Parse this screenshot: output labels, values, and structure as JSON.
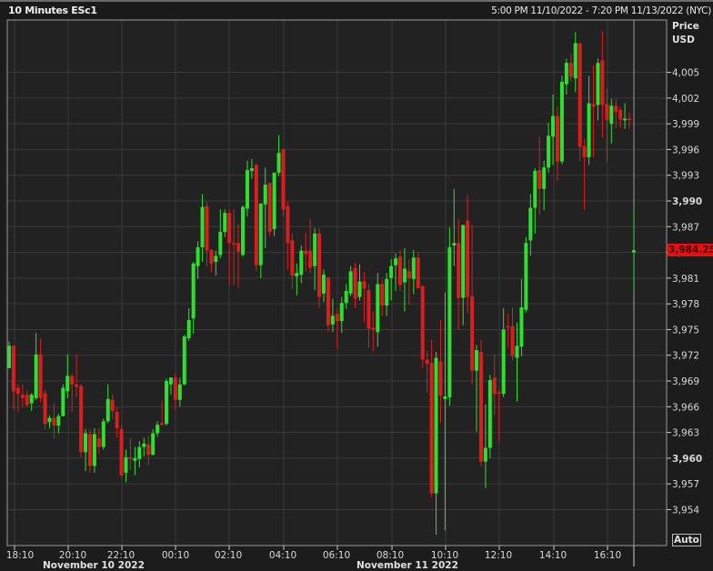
{
  "header": {
    "title": "10 Minutes ESc1",
    "range": "5:00 PM 11/10/2022 - 7:20 PM 11/13/2022 (NYC)"
  },
  "axis": {
    "price_label": "Price",
    "currency_label": "USD",
    "auto_button": "Auto"
  },
  "last_price": "3,984.25",
  "colors": {
    "up": "#2de02d",
    "down": "#d81e1e",
    "background": "#222222",
    "grid": "#3a3a3a",
    "last_price_bg": "#e61010"
  },
  "dates": [
    "November 10 2022",
    "November 11 2022"
  ],
  "chart_data": {
    "type": "candlestick",
    "title": "10 Minutes ESc1",
    "ylabel": "Price USD",
    "ylim": [
      3951,
      4010
    ],
    "grid": true,
    "y_ticks": [
      4005,
      4002,
      3999,
      3996,
      3993,
      3990,
      3987,
      3984,
      3981,
      3978,
      3975,
      3972,
      3969,
      3966,
      3963,
      3960,
      3957,
      3954
    ],
    "y_tick_labels": [
      "4,005",
      "4,002",
      "3,999",
      "3,996",
      "3,993",
      "3,990",
      "3,987",
      "3,984",
      "3,981",
      "3,978",
      "3,975",
      "3,972",
      "3,969",
      "3,966",
      "3,963",
      "3,960",
      "3,957",
      "3,954"
    ],
    "x_tick_labels": [
      "18:10",
      "20:10",
      "22:10",
      "00:10",
      "02:10",
      "04:10",
      "06:10",
      "08:10",
      "10:10",
      "12:10",
      "14:10",
      "16:10"
    ],
    "last": 3984.25,
    "ohlc": [
      [
        3970.5,
        3973.6,
        3970.5,
        3973.1
      ],
      [
        3973.1,
        3973.1,
        3965.7,
        3967.8
      ],
      [
        3968.2,
        3968.6,
        3965.4,
        3967.5
      ],
      [
        3967.4,
        3968.6,
        3966.0,
        3967.0
      ],
      [
        3967.4,
        3967.9,
        3966.0,
        3966.2
      ],
      [
        3966.4,
        3967.6,
        3965.5,
        3967.4
      ],
      [
        3967.0,
        3974.6,
        3966.8,
        3972.1
      ],
      [
        3972.1,
        3973.9,
        3966.5,
        3967.0
      ],
      [
        3967.6,
        3968.0,
        3963.3,
        3964.0
      ],
      [
        3964.2,
        3965.0,
        3963.5,
        3964.7
      ],
      [
        3964.7,
        3966.4,
        3962.3,
        3963.8
      ],
      [
        3963.8,
        3965.2,
        3962.9,
        3964.9
      ],
      [
        3964.9,
        3968.6,
        3964.9,
        3968.2
      ],
      [
        3967.8,
        3972.1,
        3967.0,
        3969.6
      ],
      [
        3969.6,
        3969.8,
        3965.4,
        3968.6
      ],
      [
        3968.6,
        3972.1,
        3967.1,
        3968.3
      ],
      [
        3968.4,
        3968.6,
        3960.1,
        3960.7
      ],
      [
        3960.7,
        3963.4,
        3958.5,
        3962.9
      ],
      [
        3962.8,
        3963.3,
        3958.3,
        3959.1
      ],
      [
        3959.1,
        3963.5,
        3958.3,
        3962.8
      ],
      [
        3962.3,
        3963.5,
        3960.5,
        3961.3
      ],
      [
        3961.3,
        3964.6,
        3961.0,
        3964.3
      ],
      [
        3964.3,
        3968.6,
        3964.1,
        3966.9
      ],
      [
        3966.8,
        3967.4,
        3964.6,
        3965.5
      ],
      [
        3965.4,
        3966.0,
        3962.4,
        3963.5
      ],
      [
        3963.4,
        3963.9,
        3957.8,
        3958.0
      ],
      [
        3958.3,
        3961.0,
        3957.2,
        3960.1
      ],
      [
        3960.1,
        3962.3,
        3958.6,
        3959.9
      ],
      [
        3959.7,
        3961.3,
        3958.0,
        3960.0
      ],
      [
        3959.9,
        3962.0,
        3958.9,
        3961.3
      ],
      [
        3961.3,
        3962.4,
        3960.2,
        3961.7
      ],
      [
        3961.6,
        3962.6,
        3959.2,
        3960.4
      ],
      [
        3960.4,
        3963.4,
        3960.3,
        3962.9
      ],
      [
        3962.9,
        3964.3,
        3962.5,
        3963.9
      ],
      [
        3964.1,
        3966.7,
        3963.8,
        3963.9
      ],
      [
        3964.0,
        3969.3,
        3963.8,
        3969.0
      ],
      [
        3968.6,
        3969.4,
        3967.4,
        3969.4
      ],
      [
        3969.4,
        3969.9,
        3965.6,
        3966.8
      ],
      [
        3966.8,
        3969.4,
        3966.0,
        3968.6
      ],
      [
        3968.6,
        3974.4,
        3968.5,
        3974.2
      ],
      [
        3974.0,
        3977.5,
        3973.7,
        3976.1
      ],
      [
        3976.3,
        3982.9,
        3974.5,
        3982.7
      ],
      [
        3982.4,
        3985.3,
        3980.9,
        3984.6
      ],
      [
        3984.6,
        3990.8,
        3982.9,
        3989.3
      ],
      [
        3989.4,
        3989.9,
        3982.4,
        3984.2
      ],
      [
        3984.3,
        3984.4,
        3981.7,
        3982.7
      ],
      [
        3982.9,
        3984.2,
        3981.3,
        3983.6
      ],
      [
        3983.7,
        3989.0,
        3983.3,
        3986.4
      ],
      [
        3986.4,
        3989.0,
        3985.8,
        3988.6
      ],
      [
        3988.6,
        3989.0,
        3980.2,
        3985.1
      ],
      [
        3985.1,
        3989.0,
        3980.2,
        3984.9
      ],
      [
        3985.1,
        3987.3,
        3979.9,
        3984.1
      ],
      [
        3983.7,
        3989.5,
        3983.5,
        3989.3
      ],
      [
        3989.1,
        3994.7,
        3988.2,
        3993.6
      ],
      [
        3993.5,
        3994.9,
        3992.6,
        3993.8
      ],
      [
        3994.2,
        3994.3,
        3981.8,
        3982.5
      ],
      [
        3982.5,
        3989.7,
        3981.0,
        3989.7
      ],
      [
        3989.6,
        3993.9,
        3984.5,
        3991.9
      ],
      [
        3992.1,
        3992.1,
        3985.9,
        3986.4
      ],
      [
        3986.7,
        3993.3,
        3985.9,
        3993.3
      ],
      [
        3993.3,
        3997.7,
        3992.9,
        3995.6
      ],
      [
        3996.0,
        3996.0,
        3988.2,
        3989.0
      ],
      [
        3989.4,
        3989.9,
        3982.0,
        3985.1
      ],
      [
        3985.4,
        3986.2,
        3979.7,
        3981.3
      ],
      [
        3981.2,
        3982.7,
        3979.0,
        3981.6
      ],
      [
        3981.4,
        3984.8,
        3980.4,
        3984.2
      ],
      [
        3984.2,
        3986.3,
        3981.8,
        3983.8
      ],
      [
        3984.2,
        3987.9,
        3981.6,
        3982.2
      ],
      [
        3982.4,
        3986.8,
        3979.6,
        3986.2
      ],
      [
        3986.2,
        3986.8,
        3977.5,
        3978.8
      ],
      [
        3979.2,
        3982.0,
        3978.2,
        3981.4
      ],
      [
        3981.1,
        3981.1,
        3974.7,
        3975.5
      ],
      [
        3975.6,
        3978.6,
        3974.7,
        3976.6
      ],
      [
        3976.8,
        3977.5,
        3972.8,
        3976.0
      ],
      [
        3976.0,
        3978.8,
        3974.6,
        3978.1
      ],
      [
        3978.1,
        3980.3,
        3977.4,
        3979.5
      ],
      [
        3979.2,
        3982.4,
        3978.9,
        3981.8
      ],
      [
        3982.2,
        3982.8,
        3977.5,
        3978.6
      ],
      [
        3978.8,
        3982.6,
        3978.4,
        3980.6
      ],
      [
        3980.6,
        3981.7,
        3975.8,
        3979.8
      ],
      [
        3979.6,
        3980.3,
        3972.9,
        3975.1
      ],
      [
        3975.2,
        3977.1,
        3972.5,
        3975.0
      ],
      [
        3974.7,
        3981.6,
        3973.0,
        3980.3
      ],
      [
        3980.3,
        3980.8,
        3976.6,
        3977.8
      ],
      [
        3977.8,
        3981.6,
        3976.6,
        3980.9
      ],
      [
        3981.0,
        3983.2,
        3978.4,
        3982.4
      ],
      [
        3982.5,
        3983.9,
        3979.5,
        3983.3
      ],
      [
        3983.5,
        3984.3,
        3979.5,
        3980.2
      ],
      [
        3980.5,
        3984.5,
        3977.1,
        3982.1
      ],
      [
        3981.8,
        3983.2,
        3977.9,
        3981.0
      ],
      [
        3980.9,
        3984.3,
        3979.1,
        3983.4
      ],
      [
        3983.4,
        3984.0,
        3979.8,
        3979.8
      ],
      [
        3980.1,
        3980.1,
        3970.5,
        3971.5
      ],
      [
        3971.5,
        3972.5,
        3967.6,
        3971.0
      ],
      [
        3971.1,
        3973.8,
        3955.5,
        3955.9
      ],
      [
        3955.9,
        3972.4,
        3951.1,
        3971.7
      ],
      [
        3971.3,
        3976.1,
        3964.1,
        3967.3
      ],
      [
        3966.9,
        3979.3,
        3951.6,
        3967.2
      ],
      [
        3967.1,
        3986.9,
        3966.1,
        3984.6
      ],
      [
        3984.8,
        3991.4,
        3982.4,
        3985.1
      ],
      [
        3985.1,
        3987.9,
        3975.0,
        3978.7
      ],
      [
        3978.7,
        3987.2,
        3975.5,
        3987.2
      ],
      [
        3987.7,
        3990.7,
        3976.9,
        3978.8
      ],
      [
        3978.9,
        3987.2,
        3968.6,
        3970.2
      ],
      [
        3970.2,
        3973.2,
        3963.1,
        3972.6
      ],
      [
        3972.4,
        3973.8,
        3959.1,
        3959.6
      ],
      [
        3959.6,
        3966.3,
        3956.5,
        3961.2
      ],
      [
        3961.2,
        3969.7,
        3960.0,
        3969.1
      ],
      [
        3969.4,
        3972.1,
        3965.0,
        3967.5
      ],
      [
        3967.7,
        3968.0,
        3962.0,
        3967.5
      ],
      [
        3967.5,
        3977.5,
        3967.1,
        3975.0
      ],
      [
        3975.4,
        3976.9,
        3972.9,
        3975.3
      ],
      [
        3975.4,
        3977.6,
        3971.4,
        3971.9
      ],
      [
        3971.7,
        3975.8,
        3966.6,
        3973.1
      ],
      [
        3973.0,
        3980.9,
        3971.9,
        3977.6
      ],
      [
        3977.3,
        3985.8,
        3977.0,
        3985.1
      ],
      [
        3985.4,
        3990.8,
        3983.6,
        3989.2
      ],
      [
        3989.2,
        3993.8,
        3986.2,
        3993.5
      ],
      [
        3993.6,
        3997.5,
        3988.4,
        3991.4
      ],
      [
        3991.4,
        3994.7,
        3988.9,
        3993.9
      ],
      [
        3993.9,
        3999.1,
        3993.3,
        3997.6
      ],
      [
        3997.5,
        4002.4,
        3994.2,
        3999.9
      ],
      [
        3999.9,
        4001.0,
        3992.3,
        3994.6
      ],
      [
        3994.6,
        4004.6,
        3994.3,
        4003.9
      ],
      [
        4003.6,
        4006.6,
        4002.4,
        4006.1
      ],
      [
        4006.1,
        4007.2,
        4003.9,
        4004.5
      ],
      [
        4004.3,
        4009.7,
        4002.7,
        4008.4
      ],
      [
        4008.4,
        4008.4,
        3994.6,
        3996.3
      ],
      [
        3996.4,
        3997.2,
        3989.0,
        3995.1
      ],
      [
        3995.1,
        4004.6,
        3994.2,
        4001.4
      ],
      [
        4001.3,
        4005.8,
        3995.1,
        4001.0
      ],
      [
        4001.2,
        4006.6,
        3999.4,
        4006.1
      ],
      [
        4006.4,
        4009.8,
        3997.4,
        4001.2
      ],
      [
        4001.3,
        4003.1,
        3994.6,
        3999.4
      ],
      [
        3999.0,
        4001.9,
        3996.7,
        4001.1
      ],
      [
        4001.1,
        4001.9,
        3998.5,
        4000.4
      ],
      [
        4000.6,
        4001.0,
        3998.5,
        3999.5
      ],
      [
        3999.4,
        4001.4,
        3998.4,
        3999.6
      ],
      [
        3999.6,
        4000.3,
        3998.4,
        3999.5
      ],
      [
        3984.0,
        3989.2,
        3979.6,
        3984.25
      ]
    ]
  }
}
